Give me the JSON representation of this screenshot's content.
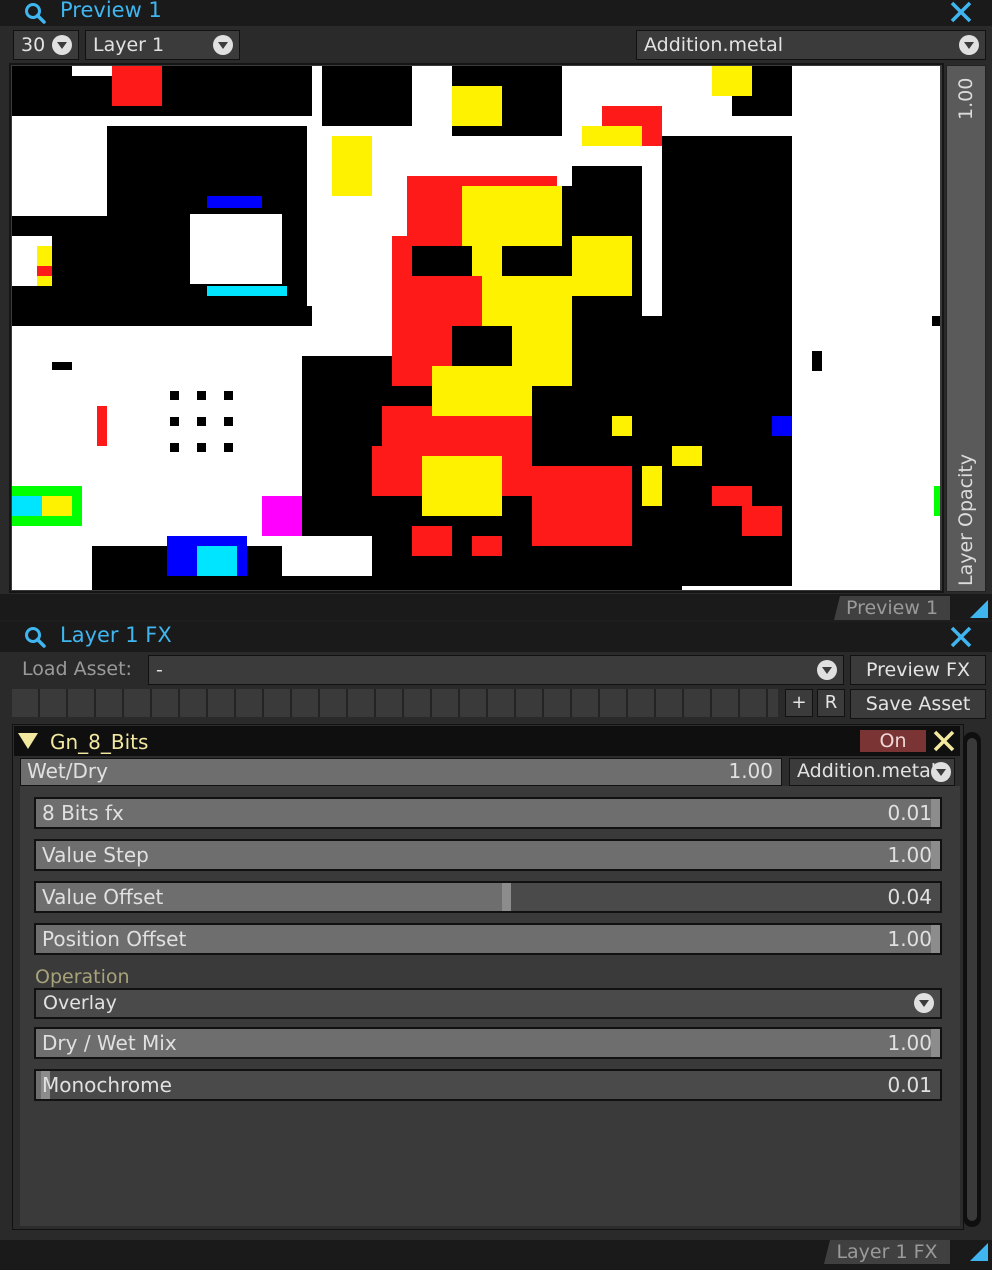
{
  "preview_panel": {
    "title": "Preview 1",
    "fps_value": "30",
    "layer_select": "Layer 1",
    "blend_select": "Addition.metal",
    "opacity_value": "1.00",
    "opacity_label": "Layer Opacity",
    "tab_label": "Preview 1"
  },
  "fx_panel": {
    "title": "Layer 1 FX",
    "load_asset_label": "Load Asset:",
    "load_asset_value": "-",
    "preview_fx_label": "Preview FX",
    "plus_label": "+",
    "r_label": "R",
    "save_asset_label": "Save Asset",
    "tab_label": "Layer 1 FX"
  },
  "effect": {
    "name": "Gn_8_Bits",
    "on_label": "On",
    "wet_dry_label": "Wet/Dry",
    "wet_dry_value": "1.00",
    "blend_mode": "Addition.metal",
    "params": [
      {
        "label": "8 Bits fx",
        "value": "0.01",
        "level": 1.0
      },
      {
        "label": "Value Step",
        "value": "1.00",
        "level": 1.0
      },
      {
        "label": "Value Offset",
        "value": "0.04",
        "level": 0.52
      },
      {
        "label": "Position Offset",
        "value": "1.00",
        "level": 1.0
      }
    ],
    "operation_label": "Operation",
    "operation_value": "Overlay",
    "params2": [
      {
        "label": "Dry / Wet Mix",
        "value": "1.00",
        "level": 1.0
      },
      {
        "label": "Monochrome",
        "value": "0.01",
        "level": 0.01
      }
    ]
  },
  "colors": {
    "accent": "#3fb6f0",
    "on_button": "#7a3434",
    "effect_name": "#f2e8a0",
    "operation_label": "#a8a27a"
  },
  "icons": [
    "search-icon",
    "close-icon",
    "chevron-down-icon",
    "collapse-triangle-icon"
  ]
}
